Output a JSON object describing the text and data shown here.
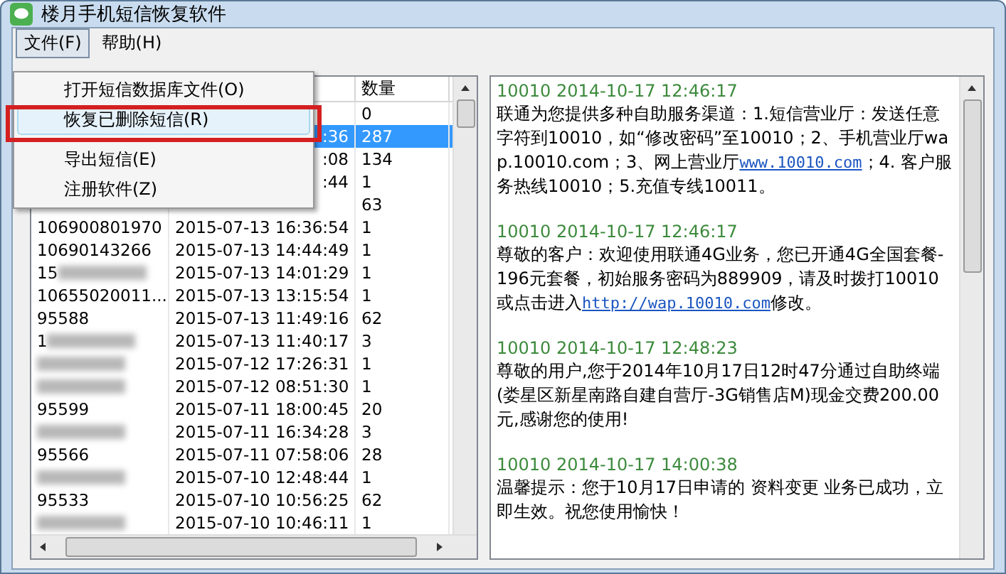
{
  "window": {
    "title": "楼月手机短信恢复软件"
  },
  "menubar": [
    {
      "label": "文件(F)",
      "selected": true
    },
    {
      "label": "帮助(H)",
      "selected": false
    }
  ],
  "menu": [
    [
      {
        "label": "打开短信数据库文件(O)",
        "highlighted": false
      },
      {
        "label": "恢复已删除短信(R)",
        "highlighted": true
      }
    ],
    [
      {
        "label": "导出短信(E)",
        "highlighted": false
      },
      {
        "label": "注册软件(Z)",
        "highlighted": false
      }
    ]
  ],
  "table": {
    "columns": [
      "数量"
    ],
    "rows": [
      {
        "count": "0",
        "selected": false
      },
      {
        "time": ":36",
        "count": "287",
        "selected": true
      },
      {
        "time": ":08",
        "count": "134",
        "selected": false
      },
      {
        "time": ":44",
        "count": "1",
        "selected": false
      },
      {
        "count": "63",
        "selected": false
      },
      {
        "number": "106900801970",
        "time": "2015-07-13 16:36:54",
        "count": "1",
        "selected": false
      },
      {
        "number": "10690143266",
        "time": "2015-07-13 14:44:49",
        "count": "1",
        "selected": false
      },
      {
        "number": "15",
        "time": "2015-07-13 14:01:29",
        "count": "1",
        "selected": false,
        "blurred": true
      },
      {
        "number": "10655020011...",
        "time": "2015-07-13 13:15:54",
        "count": "1",
        "selected": false
      },
      {
        "number": "95588",
        "time": "2015-07-13 11:49:16",
        "count": "62",
        "selected": false
      },
      {
        "number": "1",
        "time": "2015-07-13 11:40:17",
        "count": "3",
        "selected": false,
        "blurred": true
      },
      {
        "time": "2015-07-12 17:26:31",
        "count": "1",
        "selected": false,
        "blurred": true
      },
      {
        "time": "2015-07-12 08:51:30",
        "count": "1",
        "selected": false,
        "blurred": true
      },
      {
        "number": "95599",
        "time": "2015-07-11 18:00:45",
        "count": "20",
        "selected": false
      },
      {
        "time": "2015-07-11 16:34:28",
        "count": "3",
        "selected": false,
        "blurred": true
      },
      {
        "number": "95566",
        "time": "2015-07-11 07:58:06",
        "count": "28",
        "selected": false
      },
      {
        "time": "2015-07-10 12:48:44",
        "count": "1",
        "selected": false,
        "blurred": true
      },
      {
        "number": "95533",
        "time": "2015-07-10 10:56:25",
        "count": "62",
        "selected": false
      },
      {
        "time": "2015-07-10 10:46:11",
        "count": "1",
        "selected": false,
        "blurred": true
      }
    ]
  },
  "messages": [
    {
      "header": "10010 2014-10-17 12:46:17",
      "body": [
        {
          "kind": "text",
          "text": "联通为您提供多种自助服务渠道：1.短信营业厅：发送任意字符到10010，如“修改密码”至10010；2、手机营业厅wap.10010.com；3、网上营业厅"
        },
        {
          "kind": "link",
          "text": "www.10010.com"
        },
        {
          "kind": "text",
          "text": "；4. 客户服务热线10010；5.充值专线10011。"
        }
      ]
    },
    {
      "header": "10010 2014-10-17 12:46:17",
      "body": [
        {
          "kind": "text",
          "text": "尊敬的客户：欢迎使用联通4G业务，您已开通4G全国套餐-196元套餐，初始服务密码为889909，请及时拨打10010或点击进入"
        },
        {
          "kind": "link",
          "text": "http://wap.10010.com"
        },
        {
          "kind": "text",
          "text": "修改。"
        }
      ]
    },
    {
      "header": "10010 2014-10-17 12:48:23",
      "body": [
        {
          "kind": "text",
          "text": "尊敬的用户,您于2014年10月17日12时47分通过自助终端(娄星区新星南路自建自营厅-3G销售店M)现金交费200.00元,感谢您的使用!"
        }
      ]
    },
    {
      "header": "10010 2014-10-17 14:00:38",
      "body": [
        {
          "kind": "text",
          "text": "温馨提示：您于10月17日申请的 资料变更 业务已成功，立即生效。祝您使用愉快！"
        }
      ]
    }
  ]
}
